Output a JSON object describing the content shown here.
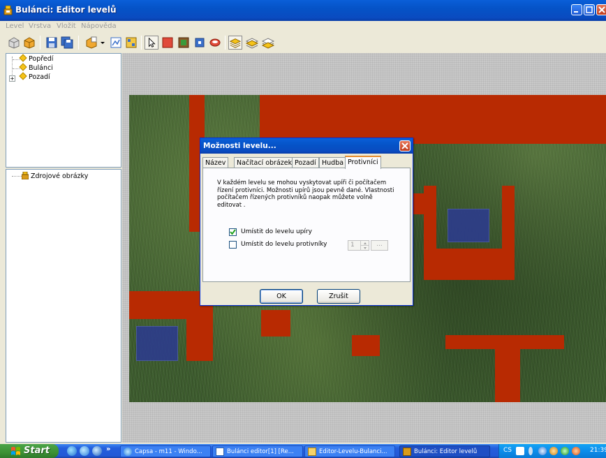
{
  "window": {
    "title": "Bulánci: Editor levelů",
    "accent_color": "#0553C7"
  },
  "menu": {
    "items": [
      "Level",
      "Vrstva",
      "Vložit",
      "Nápověda"
    ]
  },
  "toolbar": {
    "icons": [
      "new-level-icon",
      "open-level-icon",
      "save-icon",
      "save-as-icon",
      "insert-object-icon",
      "dropdown-arrow-icon",
      "image-properties-icon",
      "grid-icon",
      "pointer-icon",
      "red-block-icon",
      "picture-icon",
      "small-square-icon",
      "eraser-icon",
      "layer-1-icon",
      "layer-2-icon",
      "layer-3-icon"
    ]
  },
  "layers_tree": {
    "items": [
      {
        "label": "Popředí"
      },
      {
        "label": "Bulánci"
      },
      {
        "label": "Pozadí"
      }
    ]
  },
  "resources_tree": {
    "items": [
      {
        "label": "Zdrojové obrázky"
      }
    ]
  },
  "level_colors": {
    "obstacle": "#B82A02",
    "spawn": "#2D3C8C"
  },
  "dialog": {
    "title": "Možnosti levelu...",
    "tabs": [
      "Název",
      "Načítací obrázek",
      "Pozadí",
      "Hudba",
      "Protivníci"
    ],
    "active_tab": "Protivníci",
    "description": "V každém levelu se mohou vyskytovat upíři či počítačem řízení protivníci. Možnosti upírů jsou pevně dané. Vlastnosti počítačem řízených protivníků naopak můžete volně editovat .",
    "option_vampires": {
      "label": "Umístit do levelu upíry",
      "checked": true
    },
    "option_enemies": {
      "label": "Umístit do levelu protivníky",
      "checked": false
    },
    "enemy_count": "1",
    "more_button": "...",
    "ok": "OK",
    "cancel": "Zrušit"
  },
  "taskbar": {
    "start": "Start",
    "chevron": "»",
    "tasks": [
      {
        "label": "Capsa - m11 - Windo..."
      },
      {
        "label": "Bulánci editor[1] [Re..."
      },
      {
        "label": "Editor-Levelu-Bulanci..."
      },
      {
        "label": "Bulánci: Editor levelů"
      }
    ],
    "language": "CS",
    "clock": "21:39"
  }
}
